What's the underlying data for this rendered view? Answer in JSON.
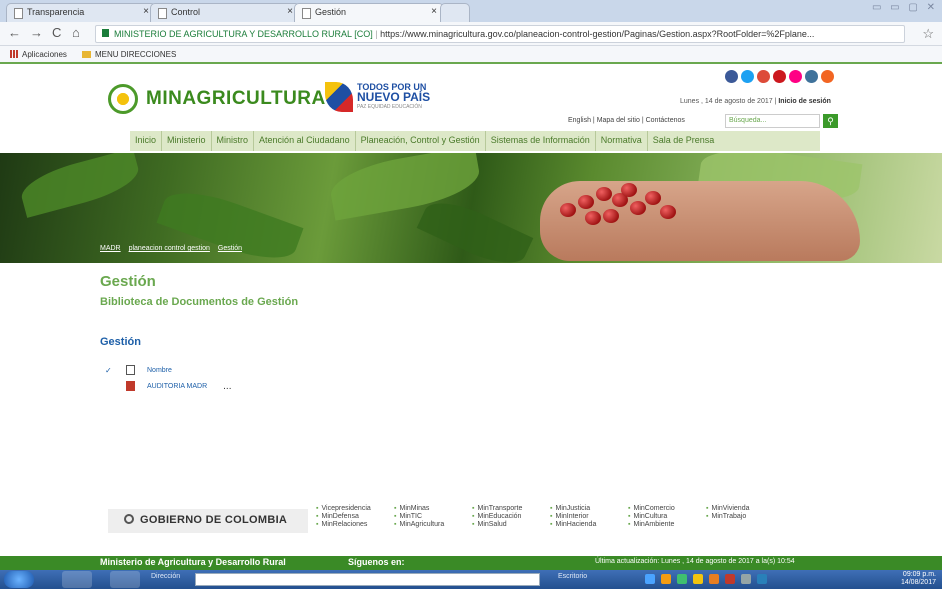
{
  "browser": {
    "tabs": [
      {
        "label": "Transparencia"
      },
      {
        "label": "Control"
      },
      {
        "label": "Gestión"
      }
    ],
    "address_secure_label": "MINISTERIO DE AGRICULTURA Y DESARROLLO RURAL [CO]",
    "address_url": "https://www.minagricultura.gov.co/planeacion-control-gestion/Paginas/Gestion.aspx?RootFolder=%2Fplane...",
    "bookmarks": [
      "Aplicaciones",
      "MENU DIRECCIONES"
    ]
  },
  "header": {
    "logo_text": "MINAGRICULTURA",
    "slogan_line1": "TODOS POR UN",
    "slogan_line2": "NUEVO PAÍS",
    "slogan_line3": "PAZ EQUIDAD EDUCACIÓN",
    "date_text": "Lunes , 14 de agosto de 2017",
    "login_link": "Inicio de sesión",
    "top_links": [
      "English",
      "Mapa del sitio",
      "Contáctenos"
    ],
    "search_placeholder": "Búsqueda..."
  },
  "nav": [
    "Inicio",
    "Ministerio",
    "Ministro",
    "Atención al Ciudadano",
    "Planeación, Control y Gestión",
    "Sistemas de Información",
    "Normativa",
    "Sala de Prensa"
  ],
  "breadcrumb": [
    "MADR",
    "planeacion control gestion",
    "Gestión"
  ],
  "page": {
    "title": "Gestión",
    "subtitle": "Biblioteca de Documentos de Gestión",
    "library_title": "Gestión",
    "column_header": "Nombre",
    "documents": [
      {
        "name": "AUDITORIA MADR",
        "menu": "..."
      }
    ]
  },
  "footer": {
    "gobierno_label": "GOBIERNO DE COLOMBIA",
    "ministries": [
      "Vicepresidencia",
      "MinMinas",
      "MinTransporte",
      "MinJusticia",
      "MinComercio",
      "MinVivienda",
      "MinDefensa",
      "MinTIC",
      "MinEducación",
      "MinInterior",
      "MinCultura",
      "MinTrabajo",
      "MinRelaciones",
      "MinAgricultura",
      "MinSalud",
      "MinHacienda",
      "MinAmbiente",
      ""
    ],
    "bar_title": "Ministerio de Agricultura y Desarrollo Rural",
    "follow_label": "Síguenos en:",
    "last_update": "Última actualización: Lunes , 14 de agosto de 2017 a la(s) 10:54"
  },
  "taskbar": {
    "address_label": "Dirección",
    "escritorio_label": "Escritorio",
    "clock_time": "09:09 p.m.",
    "clock_date": "14/08/2017"
  },
  "colors": {
    "brand_green": "#3b8a1e",
    "link_blue": "#1d5fa8",
    "footer_green": "#3a8a26"
  },
  "icons": {
    "social": [
      "facebook-icon",
      "twitter-icon",
      "google-plus-icon",
      "youtube-icon",
      "flickr-icon",
      "instagram-icon",
      "rss-icon"
    ]
  }
}
